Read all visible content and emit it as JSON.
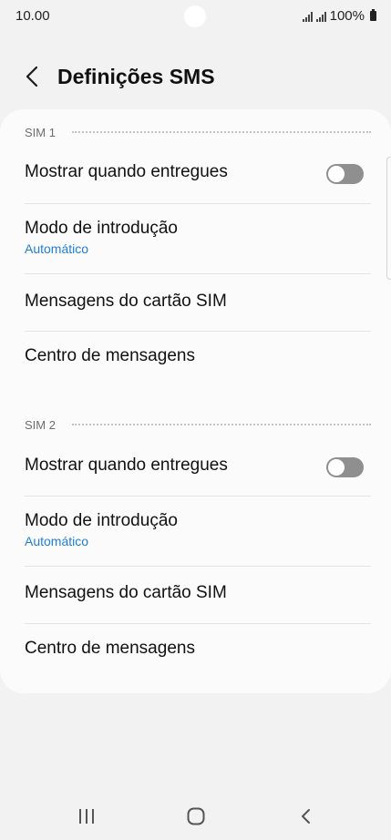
{
  "status_bar": {
    "time": "10.00",
    "battery": "100%",
    "icons": [
      "signal-icon",
      "signal-icon",
      "battery-icon"
    ]
  },
  "header": {
    "back_icon": "back-arrow-icon",
    "title": "Definições SMS"
  },
  "sections": [
    {
      "label": "SIM 1",
      "show_delivered": {
        "label": "Mostrar quando entregues",
        "enabled": false
      },
      "input_mode": {
        "label": "Modo de introdução",
        "value": "Automático"
      },
      "sim_messages": {
        "label": "Mensagens do cartão SIM"
      },
      "message_center": {
        "label": "Centro de mensagens"
      }
    },
    {
      "label": "SIM 2",
      "show_delivered": {
        "label": "Mostrar quando entregues",
        "enabled": false
      },
      "input_mode": {
        "label": "Modo de introdução",
        "value": "Automático"
      },
      "sim_messages": {
        "label": "Mensagens do cartão SIM"
      },
      "message_center": {
        "label": "Centro de mensagens"
      }
    }
  ],
  "nav_bar": {
    "icons": [
      "recent-apps-icon",
      "home-icon",
      "back-icon"
    ]
  },
  "colors": {
    "background": "#f2f2f2",
    "card": "#fbfbfb",
    "accent": "#1f7ed6",
    "toggle_off": "#8f8f8f"
  }
}
